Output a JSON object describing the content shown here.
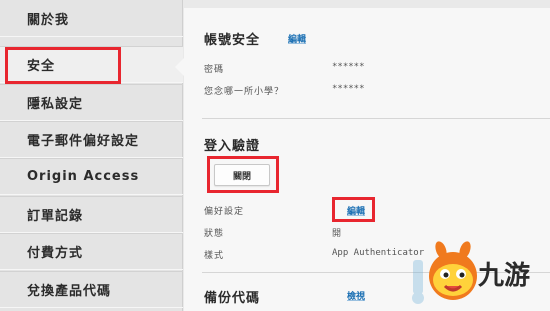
{
  "sidebar": {
    "items": [
      {
        "label": "關於我"
      },
      {
        "label": "安全"
      },
      {
        "label": "隱私設定"
      },
      {
        "label": "電子郵件偏好設定"
      },
      {
        "label": "Origin Access"
      },
      {
        "label": "訂單記錄"
      },
      {
        "label": "付費方式"
      },
      {
        "label": "兌換產品代碼"
      }
    ],
    "active_index": 1
  },
  "account_security": {
    "title": "帳號安全",
    "edit_label": "編輯",
    "rows": [
      {
        "label": "密碼",
        "value": "******"
      },
      {
        "label": "您念哪一所小學？",
        "value": "******"
      }
    ]
  },
  "login_verification": {
    "title": "登入驗證",
    "toggle_button_label": "關閉",
    "rows": [
      {
        "label": "偏好設定",
        "value": "編輯"
      },
      {
        "label": "狀態",
        "value": "開"
      },
      {
        "label": "樣式",
        "value": "App Authenticator"
      }
    ]
  },
  "backup_codes": {
    "title": "備份代碼",
    "view_label": "檢視"
  },
  "watermark": {
    "text": "九游",
    "icon": "orange-mascot-logo-icon"
  },
  "colors": {
    "highlight": "#e8262f",
    "link": "#1a6fb3",
    "logo_orange": "#f07a1e"
  }
}
